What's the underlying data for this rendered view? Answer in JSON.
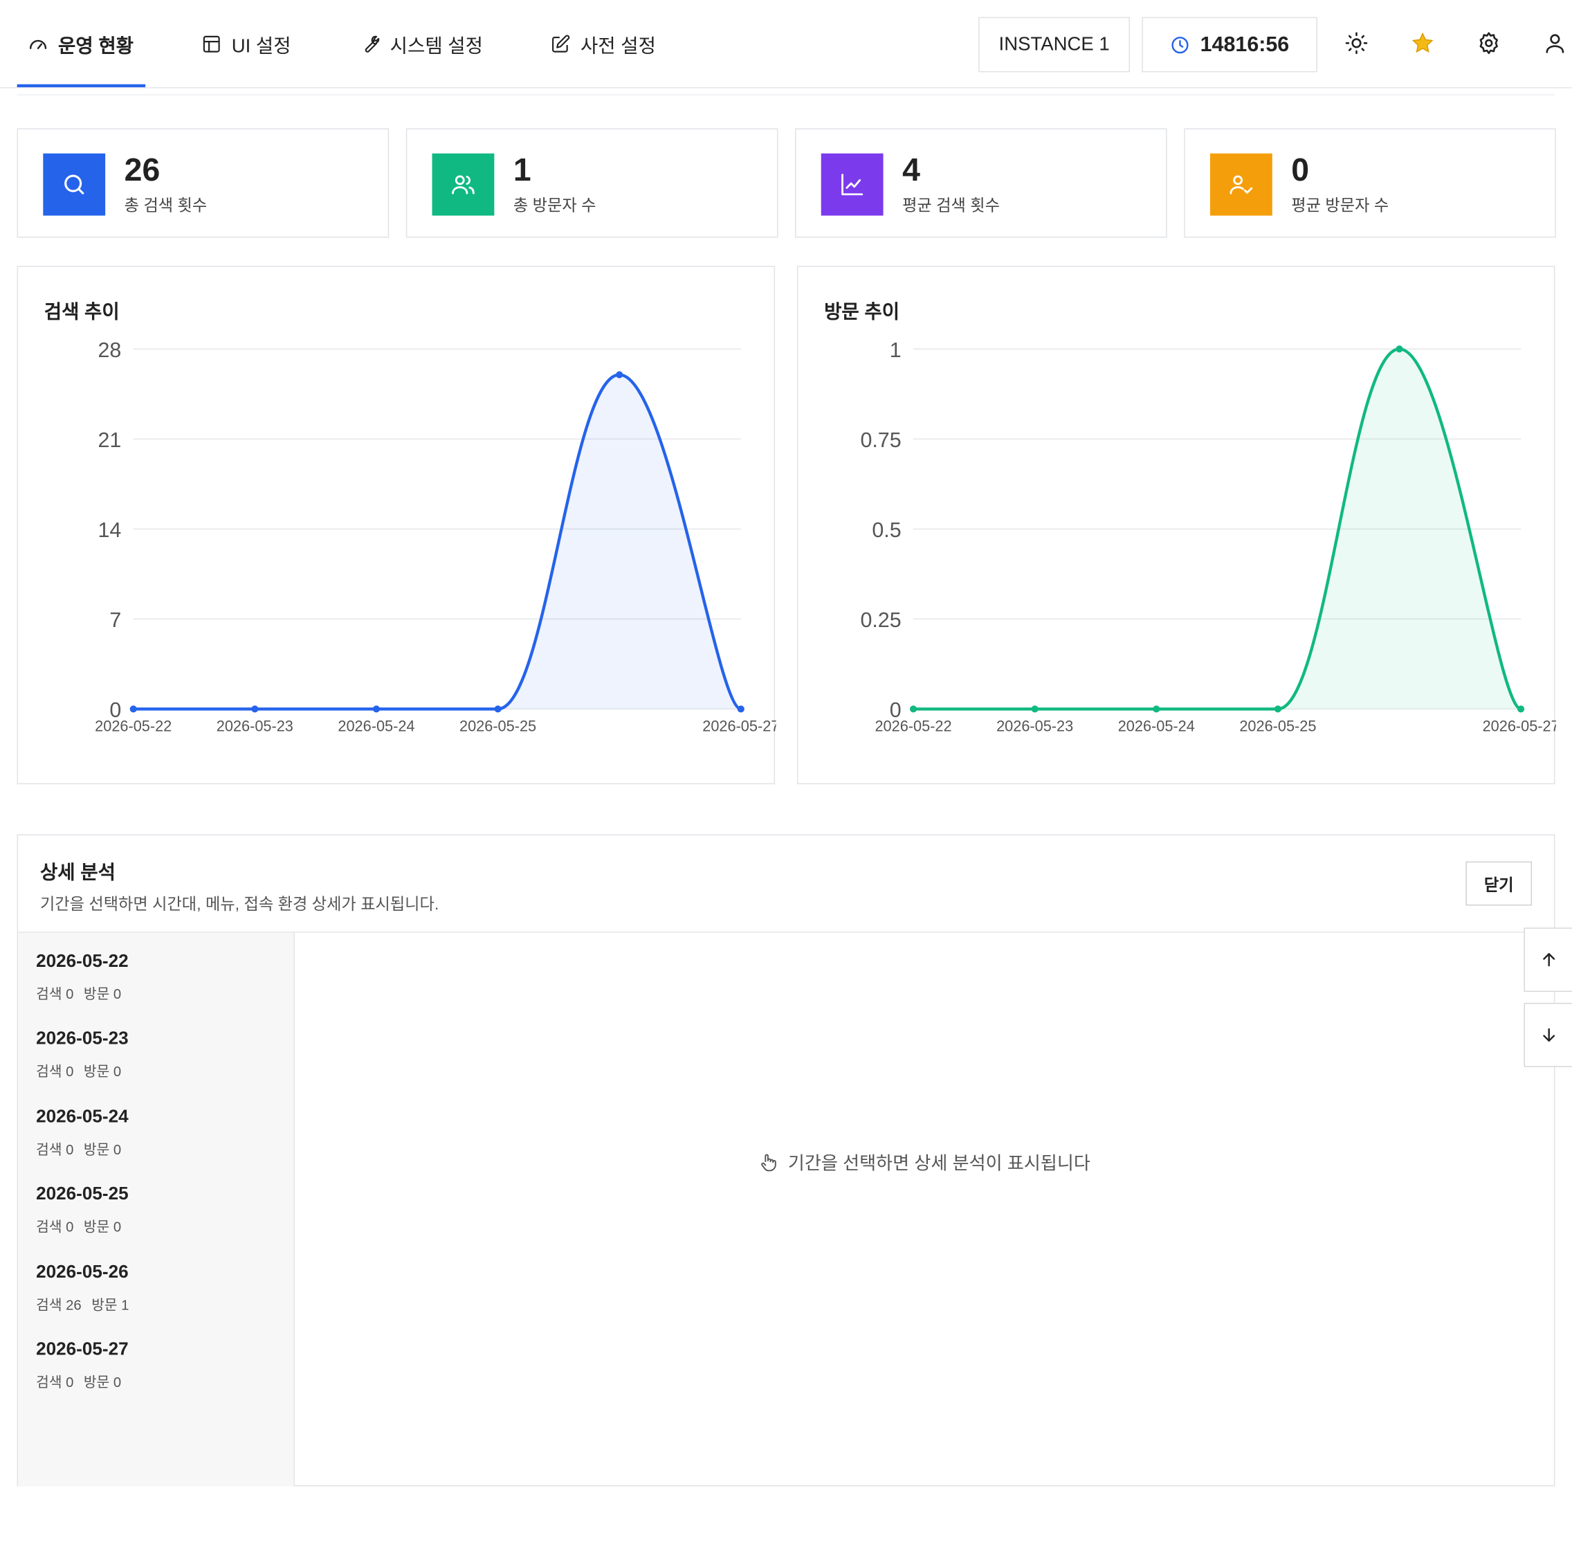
{
  "nav": {
    "tabs": [
      {
        "label": "운영 현황",
        "icon": "dashboard-gauge-icon"
      },
      {
        "label": "UI 설정",
        "icon": "layout-icon"
      },
      {
        "label": "시스템 설정",
        "icon": "wrench-icon"
      },
      {
        "label": "사전 설정",
        "icon": "edit-icon"
      }
    ],
    "active_tab": "운영 현황",
    "instance_label": "INSTANCE 1",
    "clock_value": "14816:56",
    "icons": [
      "sun-icon",
      "star-icon",
      "gear-icon",
      "user-icon"
    ]
  },
  "stats": [
    {
      "value": "26",
      "label": "총 검색 횟수",
      "color": "#2563eb",
      "icon": "search-icon"
    },
    {
      "value": "1",
      "label": "총 방문자 수",
      "color": "#10b981",
      "icon": "users-icon"
    },
    {
      "value": "4",
      "label": "평균 검색 횟수",
      "color": "#7c3aed",
      "icon": "line-chart-icon"
    },
    {
      "value": "0",
      "label": "평균 방문자 수",
      "color": "#f59e0b",
      "icon": "user-check-icon"
    }
  ],
  "charts": {
    "search": {
      "title": "검색 추이"
    },
    "visit": {
      "title": "방문 추이"
    }
  },
  "chart_data": [
    {
      "type": "area",
      "title": "검색 추이",
      "x": [
        "2026-05-22",
        "2026-05-23",
        "2026-05-24",
        "2026-05-25",
        "2026-05-26",
        "2026-05-27"
      ],
      "x_tick_labels": [
        "2026-05-22",
        "2026-05-23",
        "2026-05-24",
        "2026-05-25",
        "2026-05-27"
      ],
      "values": [
        0,
        0,
        0,
        0,
        26,
        0
      ],
      "y_ticks": [
        "0",
        "7",
        "14",
        "21",
        "28"
      ],
      "ylim": [
        0,
        28
      ],
      "grid": true,
      "color": "#2563eb"
    },
    {
      "type": "area",
      "title": "방문 추이",
      "x": [
        "2026-05-22",
        "2026-05-23",
        "2026-05-24",
        "2026-05-25",
        "2026-05-26",
        "2026-05-27"
      ],
      "x_tick_labels": [
        "2026-05-22",
        "2026-05-23",
        "2026-05-24",
        "2026-05-25",
        "2026-05-27"
      ],
      "values": [
        0,
        0,
        0,
        0,
        1,
        0
      ],
      "y_ticks": [
        "0",
        "0.25",
        "0.5",
        "0.75",
        "1"
      ],
      "ylim": [
        0,
        1
      ],
      "grid": true,
      "color": "#10b981"
    }
  ],
  "detail": {
    "title": "상세 분석",
    "subtitle": "기간을 선택하면 시간대, 메뉴, 접속 환경 상세가 표시됩니다.",
    "close_label": "닫기",
    "empty_message": "기간을 선택하면 상세 분석이 표시됩니다",
    "days": [
      {
        "date": "2026-05-22",
        "search": "검색 0",
        "visit": "방문 0"
      },
      {
        "date": "2026-05-23",
        "search": "검색 0",
        "visit": "방문 0"
      },
      {
        "date": "2026-05-24",
        "search": "검색 0",
        "visit": "방문 0"
      },
      {
        "date": "2026-05-25",
        "search": "검색 0",
        "visit": "방문 0"
      },
      {
        "date": "2026-05-26",
        "search": "검색 26",
        "visit": "방문 1"
      },
      {
        "date": "2026-05-27",
        "search": "검색 0",
        "visit": "방문 0"
      }
    ]
  }
}
